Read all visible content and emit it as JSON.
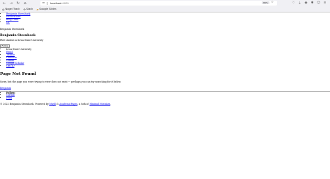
{
  "browser": {
    "url_host": "localhost",
    "url_port": ":4000",
    "zoom": "80%"
  },
  "bookmarks": [
    {
      "label": "Nagel Track",
      "icon": "globe-icon"
    },
    {
      "label": "Slack",
      "icon": "slack-icon"
    },
    {
      "label": "Google Slides",
      "icon": "folder-icon"
    }
  ],
  "page": {
    "skip_link": "Skip links",
    "nav": [
      "Benjamin Steenhoek",
      "Publications",
      "Blog Posts",
      "CV"
    ],
    "brand": "Benjamin Steenhoek",
    "author_name": "Benjamin Steenhoek",
    "author_bio": "PhD student at Iowa State University",
    "follow_button": "Follow",
    "author_links": [
      "Iowa State University",
      "Email",
      "Twitter",
      "LinkedIn",
      "Github",
      "Google Scholar",
      "ORCID"
    ],
    "not_found_title": "Page Not Found",
    "not_found_text": "Sorry, but the page you were trying to view does not exist --- perhaps you can try searching for it below.",
    "site_title": "Benjamin",
    "follow_label": "Follow:",
    "follow_links": [
      "GitHub",
      "Feed"
    ],
    "footer": {
      "prefix": "© 2022 Benjamin Steenhoek. Powered by ",
      "jekyll": "Jekyll",
      "amp": " & ",
      "academic": "AcademicPages",
      "mid": ", a fork of ",
      "mistakes": "Minimal Mistakes",
      "suffix": "."
    }
  }
}
